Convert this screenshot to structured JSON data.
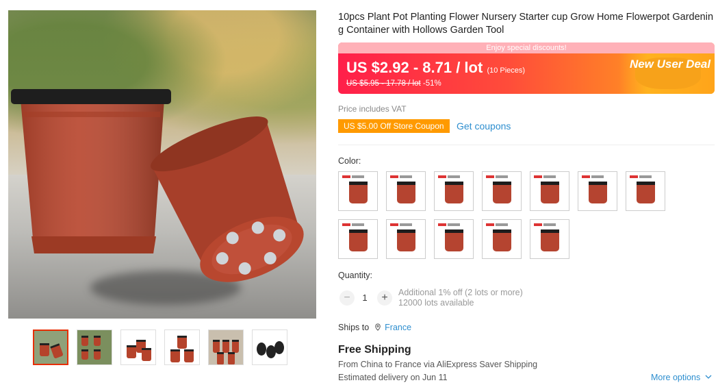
{
  "product": {
    "title": "10pcs Plant Pot Planting Flower Nursery Starter cup Grow Home Flowerpot Gardening Container with Hollows Garden Tool"
  },
  "price": {
    "discount_strip": "Enjoy special discounts!",
    "range": "US $2.92 - 8.71 / lot",
    "pieces": "(10 Pieces)",
    "original": "US $5.95 - 17.78 / lot",
    "off": "-51%",
    "deal_label": "New User Deal"
  },
  "vat_text": "Price includes VAT",
  "coupon": {
    "label": "US $5.00 Off Store Coupon",
    "link": "Get coupons"
  },
  "color": {
    "label": "Color:",
    "count": 12
  },
  "quantity": {
    "label": "Quantity:",
    "minus": "−",
    "value": "1",
    "plus": "+",
    "discount_note": "Additional 1% off (2 lots or more)",
    "available": "12000 lots available"
  },
  "shipping": {
    "ships_to_label": "Ships to",
    "location": "France",
    "free_shipping": "Free Shipping",
    "route": "From China to France via AliExpress Saver Shipping",
    "delivery": "Estimated delivery on Jun 11",
    "more_options": "More options"
  },
  "icons": {
    "location": "location-pin-icon",
    "chevron": "chevron-down-icon"
  },
  "colors": {
    "accent_red": "#e62e04",
    "link_blue": "#2d8ecf",
    "coupon_orange": "#ff9a00",
    "pot_terracotta": "#b54430"
  },
  "thumbnails": 6
}
